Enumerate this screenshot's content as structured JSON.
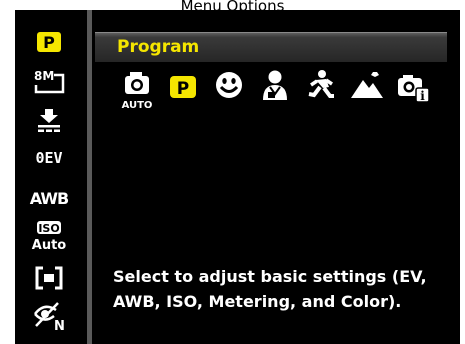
{
  "caption": "Menu Options",
  "menu": {
    "title": "Program",
    "description": "Select to adjust basic settings (EV, AWB, ISO, Metering, and Color).",
    "modes": [
      {
        "icon": "auto-camera-icon",
        "label": "AUTO"
      },
      {
        "icon": "program-icon",
        "label": "P"
      },
      {
        "icon": "smile-face-icon"
      },
      {
        "icon": "portrait-icon"
      },
      {
        "icon": "sports-icon"
      },
      {
        "icon": "landscape-icon"
      },
      {
        "icon": "camera-info-icon"
      }
    ]
  },
  "sidebar": {
    "items": [
      {
        "icon": "program-mode-icon",
        "label": "P"
      },
      {
        "icon": "resolution-8m-icon",
        "label": "8M"
      },
      {
        "icon": "quality-icon"
      },
      {
        "icon": "exposure-icon",
        "label": "0EV"
      },
      {
        "icon": "white-balance-icon",
        "label": "AWB"
      },
      {
        "icon": "iso-icon",
        "label_top": "ISO",
        "label_bottom": "Auto"
      },
      {
        "icon": "metering-icon"
      },
      {
        "icon": "color-mode-icon",
        "label": "N"
      }
    ]
  },
  "colors": {
    "accent": "#f5e600",
    "background": "#000000",
    "text": "#ffffff",
    "divider": "#5a5a5a"
  }
}
